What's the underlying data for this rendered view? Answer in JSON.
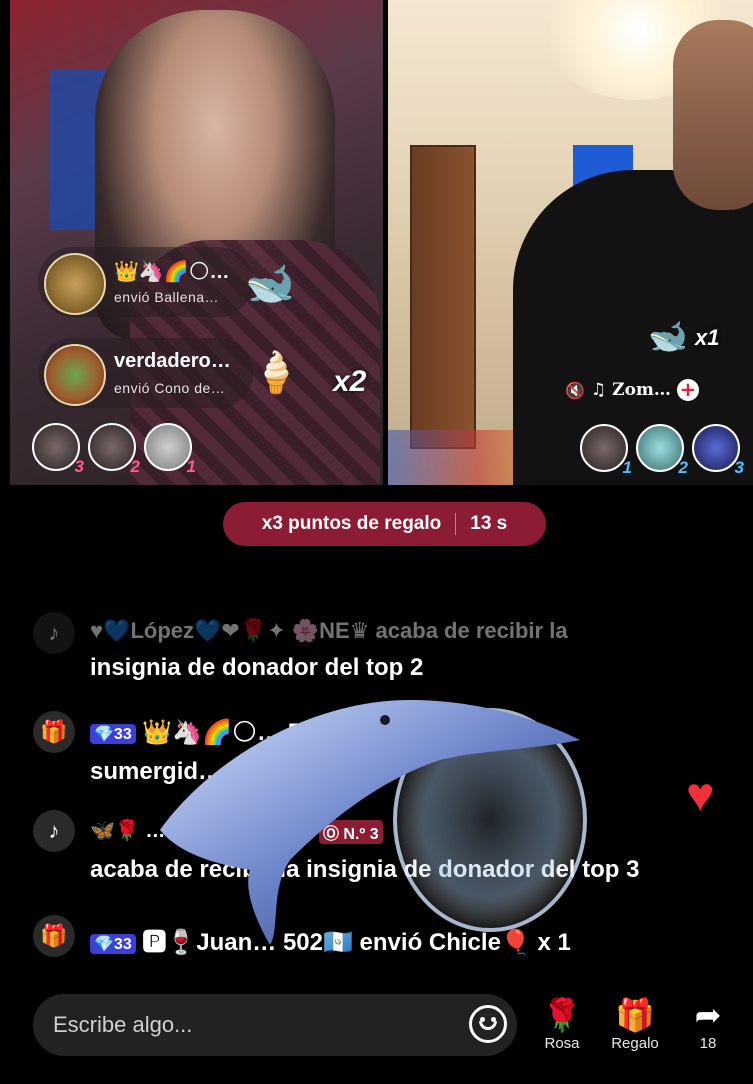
{
  "left_pane": {
    "gifts": [
      {
        "name": "👑🦄🌈🌕…",
        "sub": "envió  Ballena…",
        "icon": "whale-gift-icon"
      },
      {
        "name": "verdadero…",
        "sub": "envió  Cono de…",
        "icon": "ice-cream-gift-icon"
      }
    ],
    "multiplier": "x2",
    "ranks": [
      "3",
      "2",
      "1"
    ]
  },
  "right_pane": {
    "gift_multiplier": "x1",
    "host_name": "Zom…",
    "ranks": [
      "1",
      "2",
      "3"
    ]
  },
  "points_pill": {
    "text": "x3 puntos de regalo",
    "timer": "13 s"
  },
  "chat": [
    {
      "icon": "tiktok-icon",
      "text1": "♥💙López💙❤🌹✦ 🌸NE♛ acaba de recibir la",
      "text2": "insignia de donador del top 2"
    },
    {
      "icon": "gift-box-icon",
      "badge": "💎33",
      "text1": "👑🦄🌈🌕…  Ballena",
      "text2": "sumergid…"
    },
    {
      "icon": "tiktok-icon",
      "text1": "🦋🌹 … 🌹🦋FOR …🦋",
      "badge": "Ⓞ N.º 3",
      "text2": "acaba de recibir la insignia de donador del top 3"
    },
    {
      "icon": "gift-box-icon",
      "badge": "💎33",
      "text1": "🅿🍷Juan… 502🇬🇹 envió Chicle🎈 x 1"
    }
  ],
  "input": {
    "placeholder": "Escribe algo..."
  },
  "actions": [
    {
      "label": "Rosa",
      "icon": "rose-icon"
    },
    {
      "label": "Regalo",
      "icon": "gift-icon"
    },
    {
      "label": "18",
      "icon": "share-icon"
    }
  ]
}
